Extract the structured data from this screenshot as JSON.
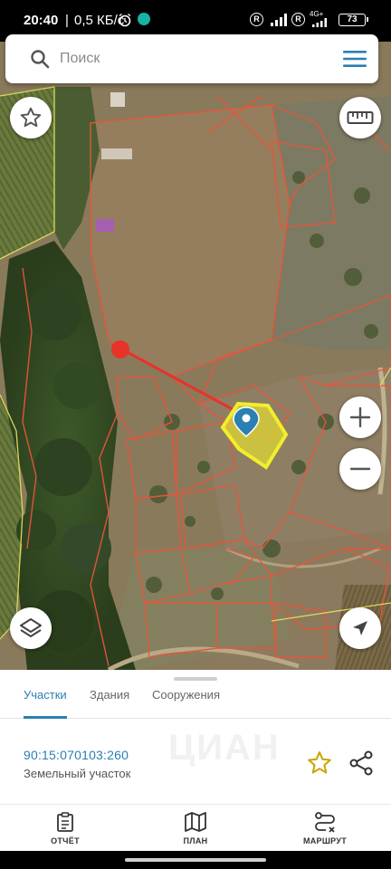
{
  "status_bar": {
    "time": "20:40",
    "separator": "|",
    "speed": "0,5 КБ/с",
    "network": "4G+",
    "battery": "73",
    "roaming_badge": "R"
  },
  "search": {
    "placeholder": "Поиск"
  },
  "map": {
    "colors": {
      "selected_parcel": "#f2ee2a",
      "parcel_border": "#e8553a",
      "marker": "#2a7fb3"
    }
  },
  "sheet": {
    "tabs": [
      {
        "label": "Участки",
        "active": true
      },
      {
        "label": "Здания",
        "active": false
      },
      {
        "label": "Сооружения",
        "active": false
      }
    ],
    "parcel": {
      "cadastral_number": "90:15:070103:260",
      "type": "Земельный участок"
    },
    "watermark": "ЦИАН"
  },
  "bottom_nav": [
    {
      "label": "ОТЧЁТ",
      "icon": "clipboard-icon"
    },
    {
      "label": "ПЛАН",
      "icon": "map-icon"
    },
    {
      "label": "МАРШРУТ",
      "icon": "route-icon"
    }
  ]
}
